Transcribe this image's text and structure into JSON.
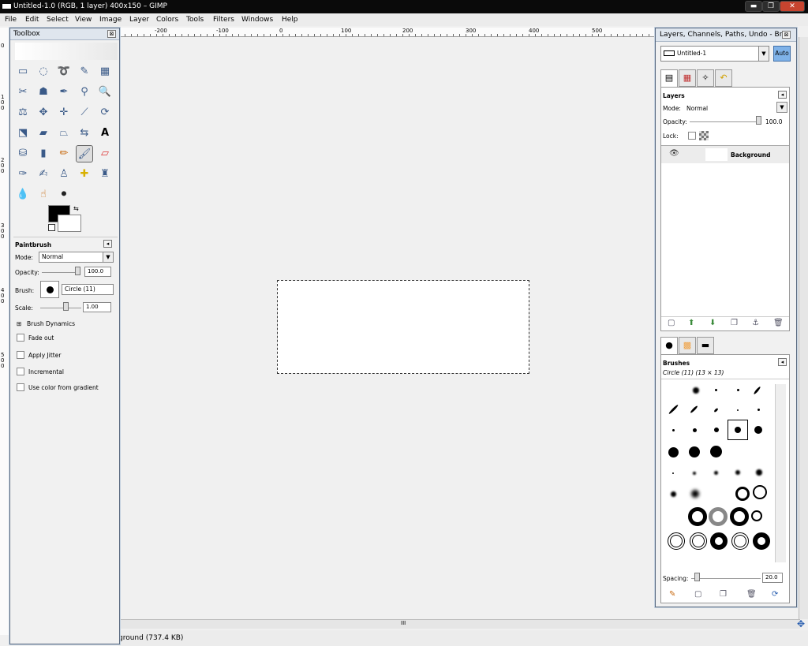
{
  "window": {
    "title": "Untitled-1.0 (RGB, 1 layer) 400x150 – GIMP",
    "min": "▬",
    "max": "❐",
    "close": "✕"
  },
  "menu": [
    "File",
    "Edit",
    "Select",
    "View",
    "Image",
    "Layer",
    "Colors",
    "Tools",
    "Filters",
    "Windows",
    "Help"
  ],
  "ruler": {
    "h": [
      "-200",
      "-100",
      "0",
      "100",
      "200",
      "300",
      "400",
      "500"
    ],
    "v": [
      "0",
      "1 0 0",
      "2 0 0",
      "3 0 0",
      "4 0 0",
      "5 0 0"
    ]
  },
  "status": {
    "text": "ground (737.4 KB)"
  },
  "toolbox": {
    "title": "Toolbox",
    "close": "⊠"
  },
  "tool_options": {
    "title": "Paintbrush",
    "mode_label": "Mode:",
    "mode_value": "Normal",
    "opacity_label": "Opacity:",
    "opacity_value": "100.0",
    "brush_label": "Brush:",
    "brush_value": "Circle (11)",
    "scale_label": "Scale:",
    "scale_value": "1.00",
    "dynamics": "Brush Dynamics",
    "checks": [
      "Fade out",
      "Apply Jitter",
      "Incremental",
      "Use color from gradient"
    ]
  },
  "dock": {
    "title": "Layers, Channels, Paths, Undo - Br...",
    "image_combo": "Untitled-1",
    "auto": "Auto",
    "layers": {
      "title": "Layers",
      "mode_label": "Mode:",
      "mode_value": "Normal",
      "opacity_label": "Opacity:",
      "opacity_value": "100.0",
      "lock_label": "Lock:",
      "layer_name": "Background"
    },
    "brushes": {
      "title": "Brushes",
      "subtitle": "Circle (11) (13 × 13)",
      "spacing_label": "Spacing:",
      "spacing_value": "20.0"
    }
  },
  "colors": {
    "accent": "#3a5a88",
    "selection_border": "#333333"
  }
}
